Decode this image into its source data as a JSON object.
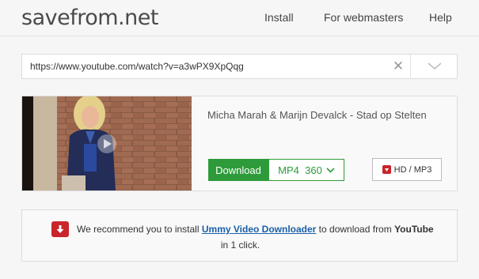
{
  "header": {
    "logo": "savefrom.net",
    "nav": {
      "install": "Install",
      "webmasters": "For webmasters",
      "help": "Help"
    }
  },
  "search": {
    "url_value": "https://www.youtube.com/watch?v=a3wPX9XpQqg",
    "clear_symbol": "✕"
  },
  "result": {
    "title": "Micha Marah & Marijn Devalck - Stad op Stelten",
    "download_label": "Download",
    "format_label": "MP4  360",
    "hd_label": "HD / MP3"
  },
  "recommendation": {
    "prefix": "We recommend you to install ",
    "link_text": "Ummy Video Downloader",
    "middle": " to download from ",
    "bold_text": "YouTube",
    "suffix": "in 1 click."
  },
  "colors": {
    "download_green": "#2e9b3a",
    "alert_red": "#c9252b",
    "link_blue": "#1a5fa8"
  },
  "icons": {
    "clear": "close-icon",
    "dropdown": "chevron-down-icon",
    "format_caret": "chevron-down-icon",
    "hd": "download-icon",
    "recommend": "download-arrow-icon",
    "play": "play-icon"
  }
}
